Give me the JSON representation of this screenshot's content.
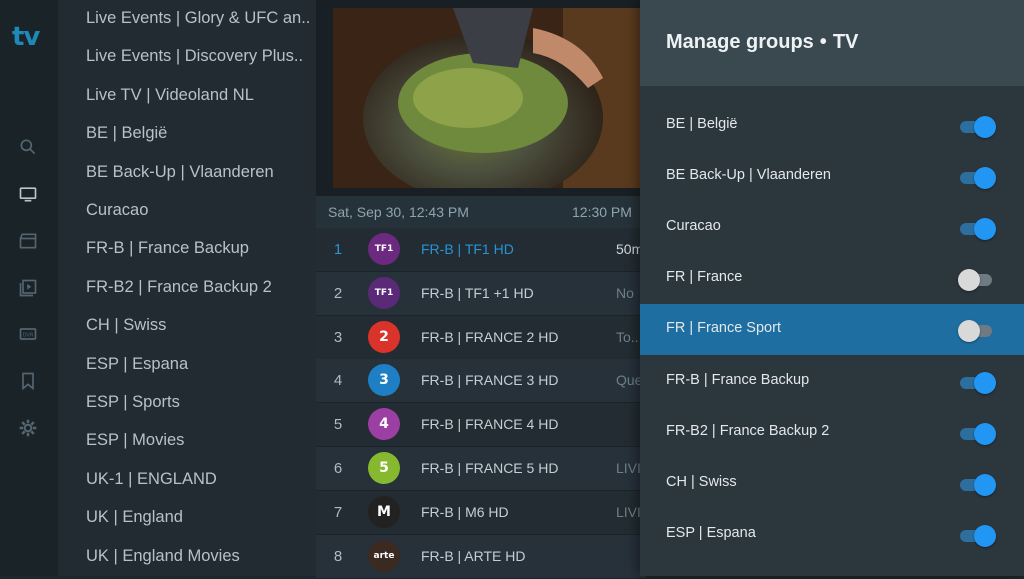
{
  "app": {
    "logo_text": "tv"
  },
  "rail": [
    {
      "icon": "search-icon"
    },
    {
      "icon": "tv-icon"
    },
    {
      "icon": "movie-clapper-icon"
    },
    {
      "icon": "series-play-icon"
    },
    {
      "icon": "dvr-icon"
    },
    {
      "icon": "bookmark-icon"
    },
    {
      "icon": "gear-icon"
    }
  ],
  "groups": [
    "Live Events | Glory & UFC an..",
    "Live Events | Discovery Plus..",
    "Live TV | Videoland NL",
    "BE | België",
    "BE Back-Up | Vlaanderen",
    "Curacao",
    "FR-B | France Backup",
    "FR-B2 | France Backup 2",
    "CH | Swiss",
    "ESP | Espana",
    "ESP | Sports",
    "ESP | Movies",
    "UK-1 | ENGLAND",
    "UK | England",
    "UK | England Movies"
  ],
  "epg": {
    "date": "Sat, Sep 30, 12:43 PM",
    "time": "12:30 PM"
  },
  "channels": [
    {
      "num": "1",
      "name": "FR-B | TF1 HD",
      "program": "50m",
      "logo": "TF1",
      "logo_color": "#6b2a7f",
      "selected": true
    },
    {
      "num": "2",
      "name": "FR-B | TF1 +1 HD",
      "program": "No",
      "logo": "TF1",
      "logo_color": "#5a2a78"
    },
    {
      "num": "3",
      "name": "FR-B | FRANCE 2 HD",
      "program": "To...",
      "logo": "2",
      "logo_color": "#d9332b"
    },
    {
      "num": "4",
      "name": "FR-B | FRANCE 3 HD",
      "program": "Que",
      "logo": "3",
      "logo_color": "#1f7fc4"
    },
    {
      "num": "5",
      "name": "FR-B | FRANCE 4 HD",
      "program": "",
      "logo": "4",
      "logo_color": "#9c3fa3"
    },
    {
      "num": "6",
      "name": "FR-B | FRANCE 5 HD",
      "program": "LIVI",
      "logo": "5",
      "logo_color": "#86b830"
    },
    {
      "num": "7",
      "name": "FR-B | M6 HD",
      "program": "LIVI",
      "logo": "M",
      "logo_color": "#222222"
    },
    {
      "num": "8",
      "name": "FR-B | ARTE HD",
      "program": "",
      "logo": "arte",
      "logo_color": "#3a2a22"
    }
  ],
  "panel": {
    "title": "Manage groups",
    "separator": "•",
    "subtitle": "TV",
    "items": [
      {
        "label": "BE | België",
        "on": true
      },
      {
        "label": "BE Back-Up | Vlaanderen",
        "on": true
      },
      {
        "label": "Curacao",
        "on": true
      },
      {
        "label": "FR | France",
        "on": false
      },
      {
        "label": "FR | France Sport",
        "on": false,
        "highlighted": true
      },
      {
        "label": "FR-B | France Backup",
        "on": true
      },
      {
        "label": "FR-B2 | France Backup 2",
        "on": true
      },
      {
        "label": "CH | Swiss",
        "on": true
      },
      {
        "label": "ESP | Espana",
        "on": true
      }
    ]
  },
  "colors": {
    "accent": "#2196f3",
    "highlight": "#1e6ea1",
    "panel": "#2b363d"
  }
}
